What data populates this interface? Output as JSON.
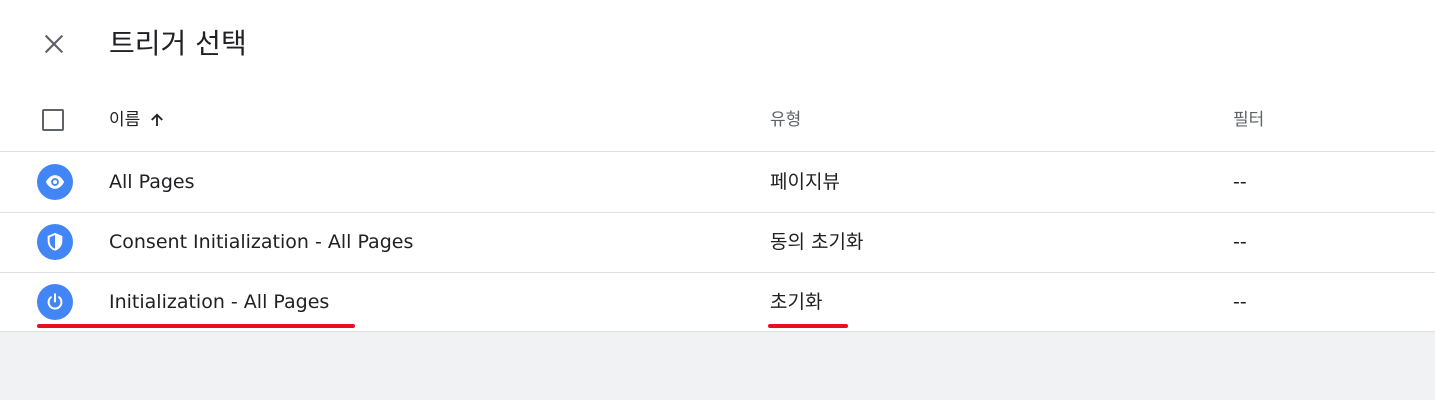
{
  "dialog": {
    "title": "트리거 선택",
    "close_icon": "close-icon"
  },
  "table": {
    "columns": {
      "name": "이름",
      "type": "유형",
      "filter": "필터"
    },
    "sort_icon": "arrow-up-icon",
    "rows": [
      {
        "icon": "eye-icon",
        "name": "All Pages",
        "type": "페이지뷰",
        "filter": "--"
      },
      {
        "icon": "shield-icon",
        "name": "Consent Initialization - All Pages",
        "type": "동의 초기화",
        "filter": "--"
      },
      {
        "icon": "power-icon",
        "name": "Initialization - All Pages",
        "type": "초기화",
        "filter": "--"
      }
    ]
  },
  "colors": {
    "icon_background": "#4285f4",
    "highlight_underline": "#e8101e"
  }
}
